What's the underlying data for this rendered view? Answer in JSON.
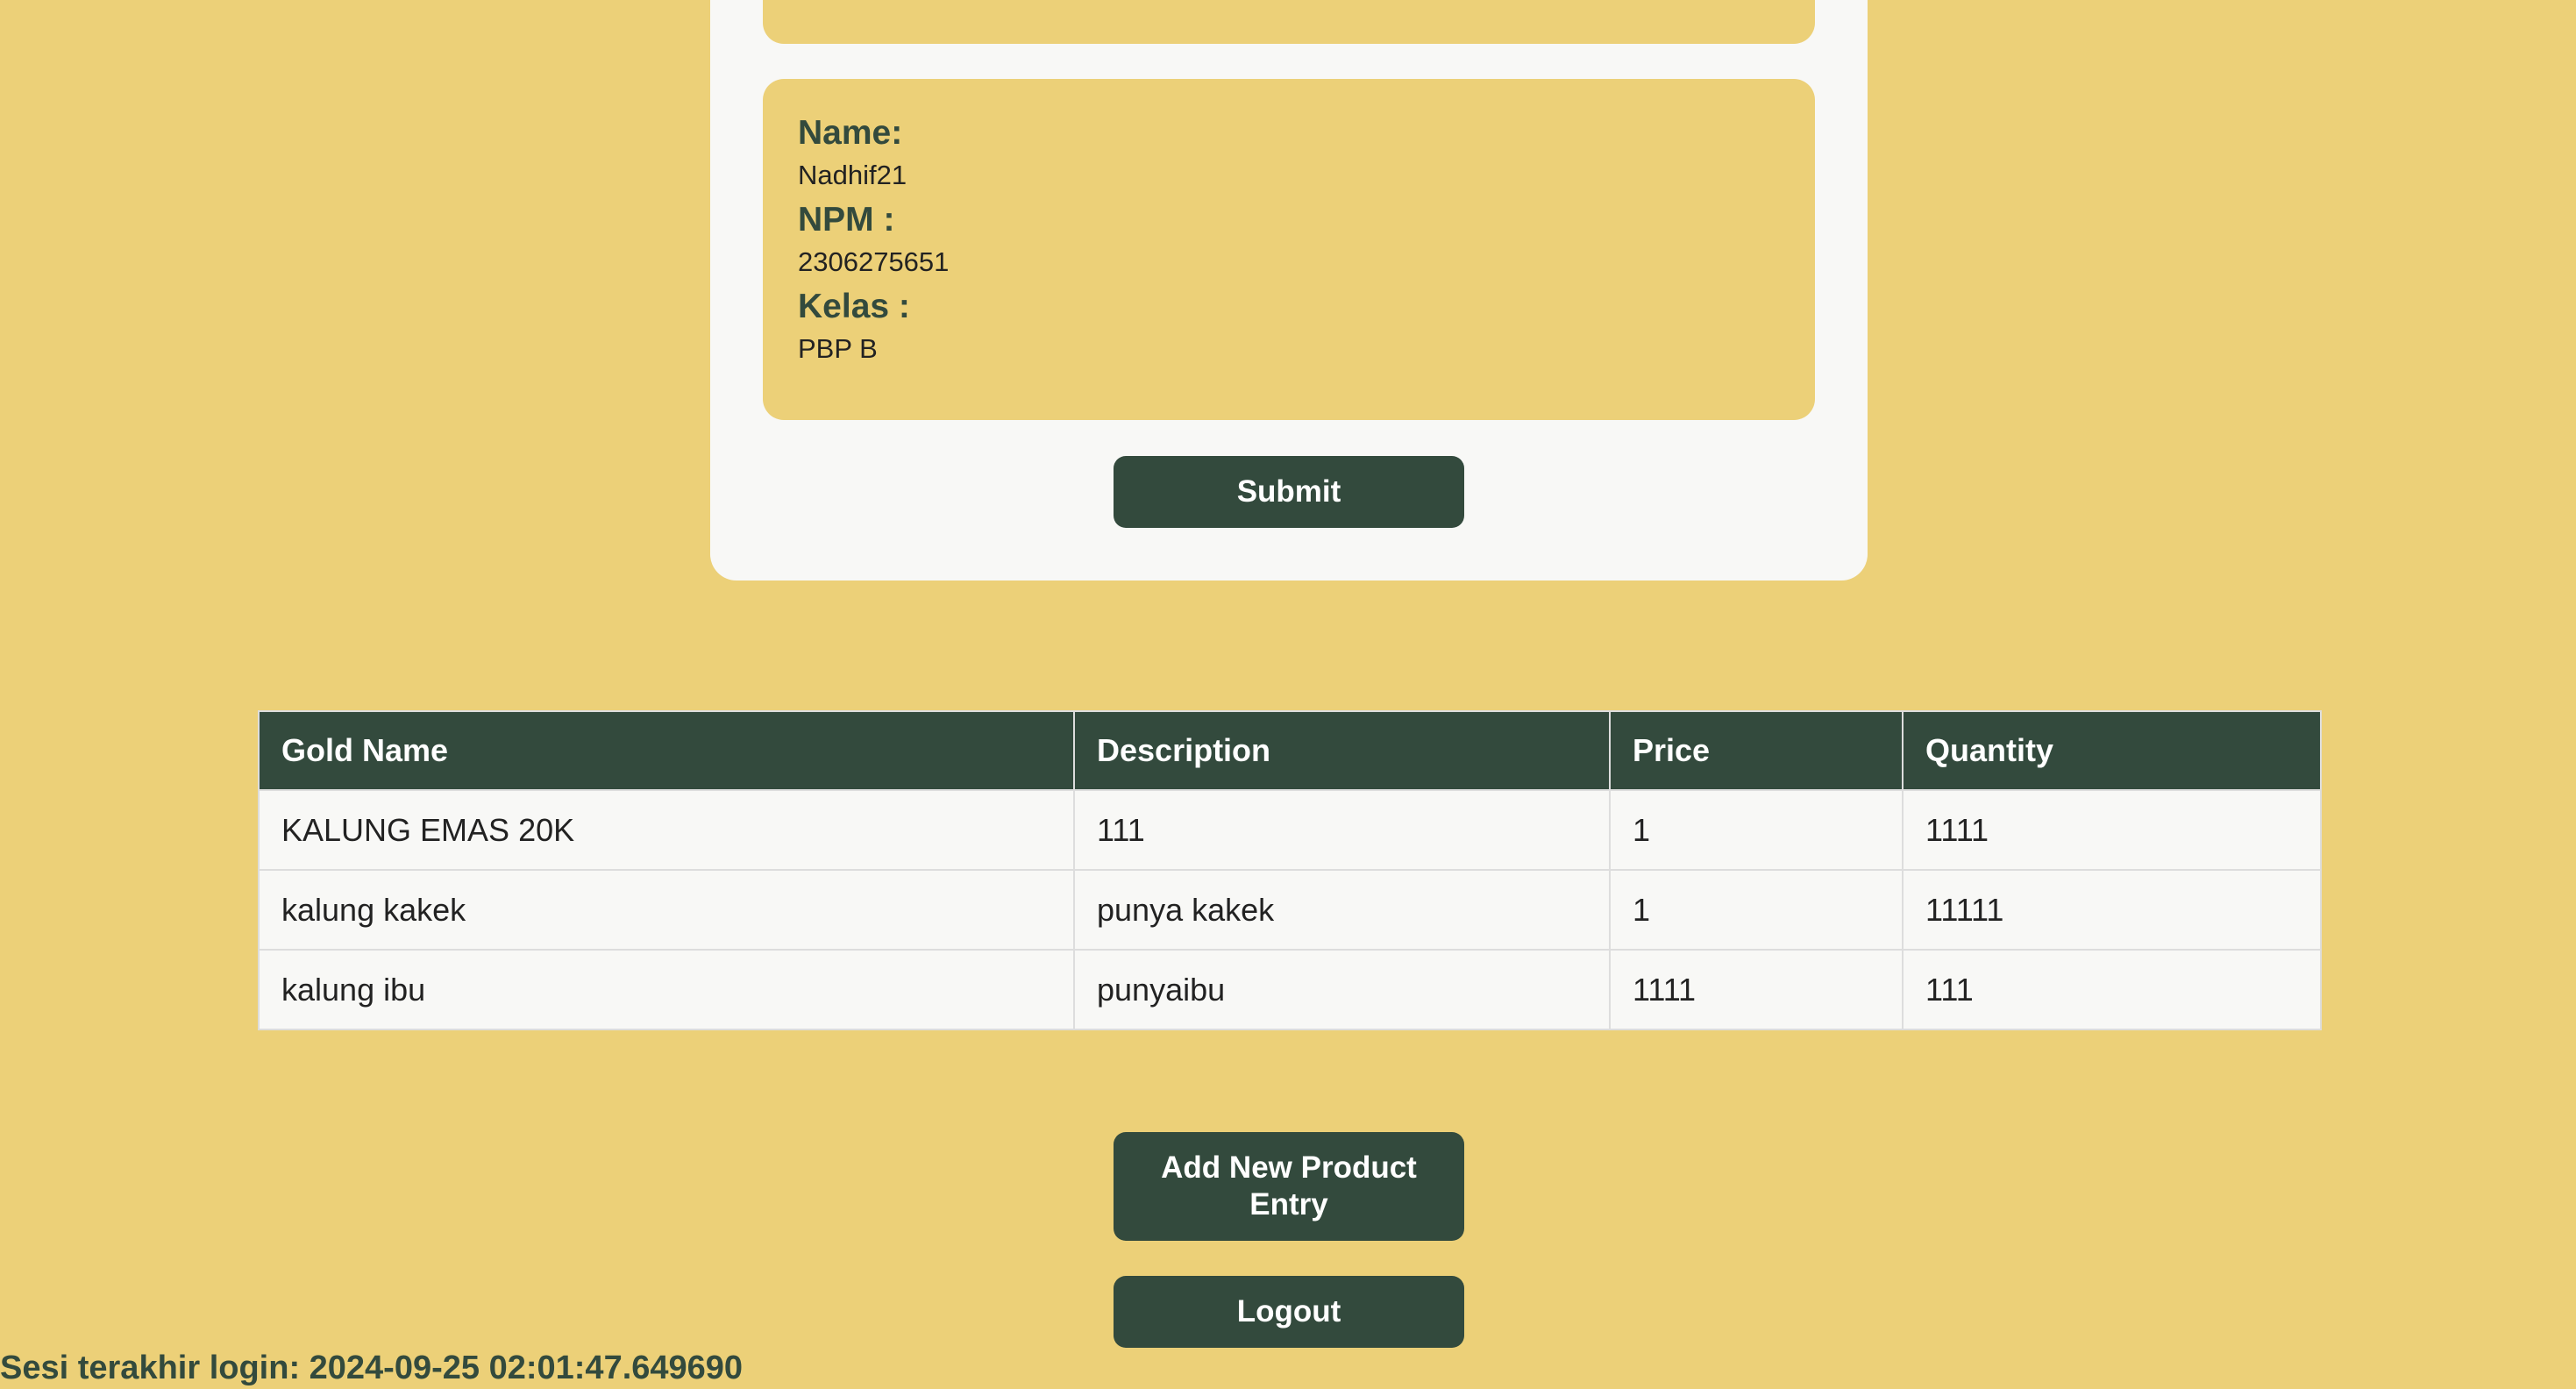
{
  "colors": {
    "background": "#ECD078",
    "card": "#F8F8F6",
    "accent": "#334A3D"
  },
  "profile": {
    "name_label": "Name:",
    "name_value": "Nadhif21",
    "npm_label": "NPM :",
    "npm_value": "2306275651",
    "kelas_label": "Kelas :",
    "kelas_value": "PBP B"
  },
  "buttons": {
    "submit": "Submit",
    "add_product": "Add New Product Entry",
    "logout": "Logout"
  },
  "table": {
    "headers": [
      "Gold Name",
      "Description",
      "Price",
      "Quantity"
    ],
    "rows": [
      [
        "KALUNG EMAS 20K",
        "111",
        "1",
        "1111"
      ],
      [
        "kalung kakek",
        "punya kakek",
        "1",
        "11111"
      ],
      [
        "kalung ibu",
        "punyaibu",
        "1111",
        "111"
      ]
    ]
  },
  "footer": {
    "last_login": "Sesi terakhir login: 2024-09-25 02:01:47.649690"
  }
}
